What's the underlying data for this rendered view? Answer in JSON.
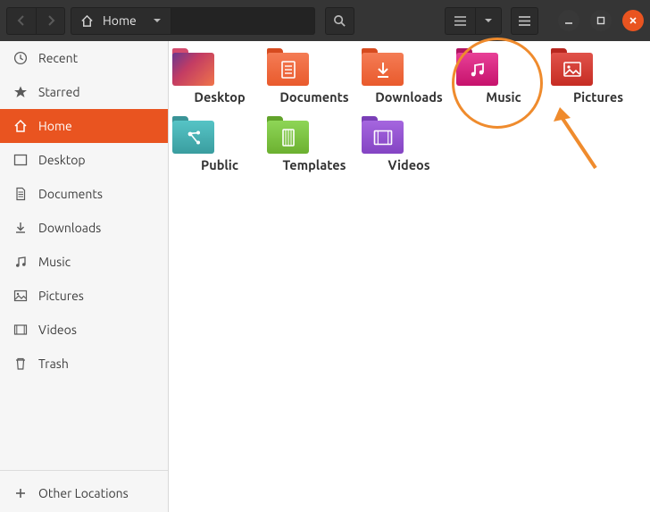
{
  "path": {
    "label": "Home"
  },
  "sidebar": {
    "items": [
      {
        "label": "Recent"
      },
      {
        "label": "Starred"
      },
      {
        "label": "Home"
      },
      {
        "label": "Desktop"
      },
      {
        "label": "Documents"
      },
      {
        "label": "Downloads"
      },
      {
        "label": "Music"
      },
      {
        "label": "Pictures"
      },
      {
        "label": "Videos"
      },
      {
        "label": "Trash"
      }
    ],
    "other": {
      "label": "Other Locations"
    }
  },
  "folders": [
    {
      "label": "Desktop"
    },
    {
      "label": "Documents"
    },
    {
      "label": "Downloads"
    },
    {
      "label": "Music"
    },
    {
      "label": "Pictures"
    },
    {
      "label": "Public"
    },
    {
      "label": "Templates"
    },
    {
      "label": "Videos"
    }
  ]
}
